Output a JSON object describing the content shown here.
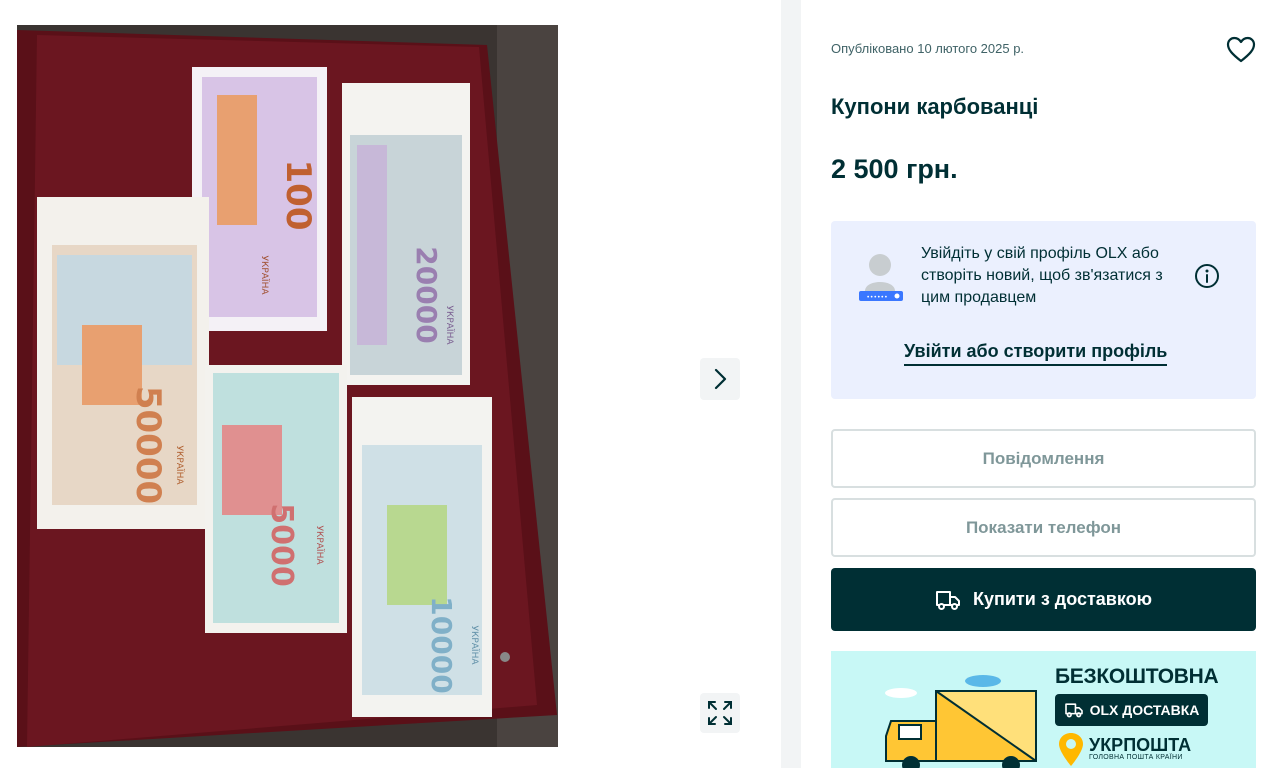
{
  "listing": {
    "published": "Опубліковано 10 лютого 2025 р.",
    "title": "Купони карбованці",
    "price": "2 500 грн."
  },
  "login_prompt": {
    "text": "Увійдіть у свій профіль OLX або створіть новий, щоб зв'язатися з цим продавцем",
    "link_label": "Увійти або створити профіль"
  },
  "actions": {
    "message_label": "Повідомлення",
    "phone_label": "Показати телефон",
    "buy_label": "Купити з доставкою"
  },
  "promo": {
    "headline": "БЕЗКОШТОВНА",
    "badge": "OLX ДОСТАВКА",
    "carrier": "УКРПОШТА",
    "carrier_sub": "ГОЛОВНА ПОШТА КРАЇНИ"
  },
  "photo": {
    "banknotes": [
      {
        "denomination": "100",
        "country": "УКРАЇНА"
      },
      {
        "denomination": "20000",
        "country": "УКРАЇНА"
      },
      {
        "denomination": "50000",
        "country": "УКРАЇНА"
      },
      {
        "denomination": "5000",
        "country": "УКРАЇНА"
      },
      {
        "denomination": "10000",
        "country": "УКРАЇНА"
      }
    ]
  },
  "icons": {
    "favorite": "heart-icon",
    "next": "chevron-right-icon",
    "expand": "expand-icon",
    "info": "info-icon",
    "delivery": "truck-icon"
  },
  "colors": {
    "brand_dark": "#002f34",
    "login_bg": "#ebf0fe",
    "promo_bg": "#c8f8f6",
    "outline": "#d8dfe0"
  }
}
